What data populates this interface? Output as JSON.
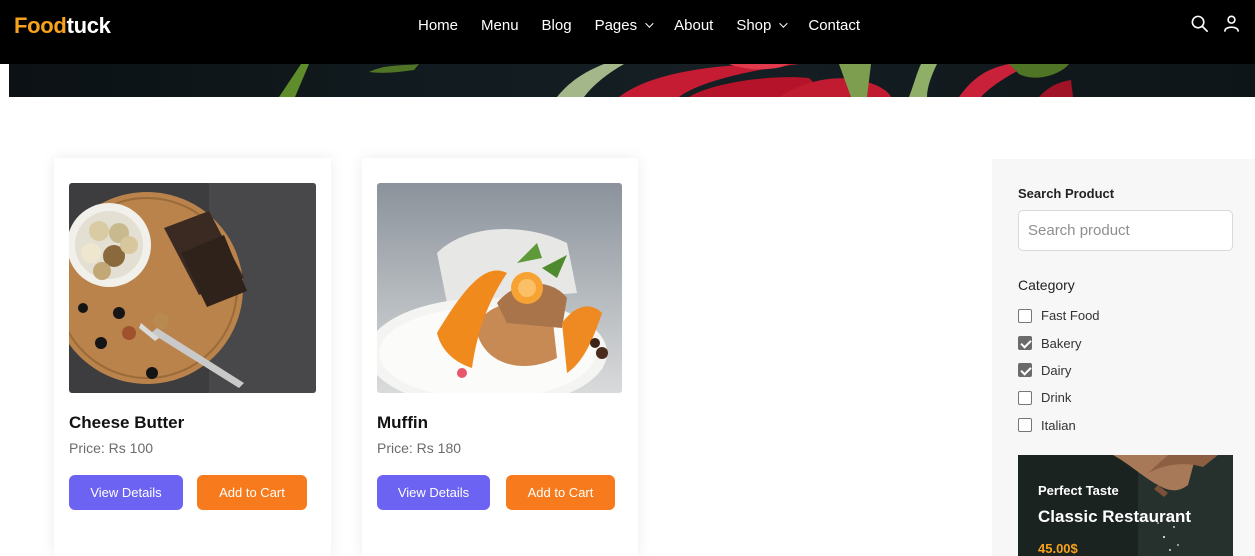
{
  "brand": {
    "part1": "Food",
    "part2": "tuck"
  },
  "nav": [
    {
      "label": "Home",
      "dropdown": false
    },
    {
      "label": "Menu",
      "dropdown": false
    },
    {
      "label": "Blog",
      "dropdown": false
    },
    {
      "label": "Pages",
      "dropdown": true
    },
    {
      "label": "About",
      "dropdown": false
    },
    {
      "label": "Shop",
      "dropdown": true
    },
    {
      "label": "Contact",
      "dropdown": false
    }
  ],
  "header_icons": [
    "search-icon",
    "user-icon"
  ],
  "products": [
    {
      "name": "Cheese Butter",
      "price": "Price: Rs 100",
      "view_label": "View Details",
      "cart_label": "Add to Cart"
    },
    {
      "name": "Muffin",
      "price": "Price: Rs 180",
      "view_label": "View Details",
      "cart_label": "Add to Cart"
    }
  ],
  "sidebar": {
    "search_title": "Search Product",
    "search_placeholder": "Search product",
    "search_value": "",
    "category_title": "Category",
    "categories": [
      {
        "label": "Fast Food",
        "checked": false
      },
      {
        "label": "Bakery",
        "checked": true
      },
      {
        "label": "Dairy",
        "checked": true
      },
      {
        "label": "Drink",
        "checked": false
      },
      {
        "label": "Italian",
        "checked": false
      }
    ],
    "promo": {
      "line1": "Perfect Taste",
      "line2": "Classic Restaurant",
      "price": "45.00$"
    }
  },
  "colors": {
    "brand_orange": "#f7a21b",
    "view_button": "#6c63f2",
    "cart_button": "#f77a1c",
    "navbar_bg": "#000000",
    "checkbox_checked": "#6b6b6b"
  }
}
